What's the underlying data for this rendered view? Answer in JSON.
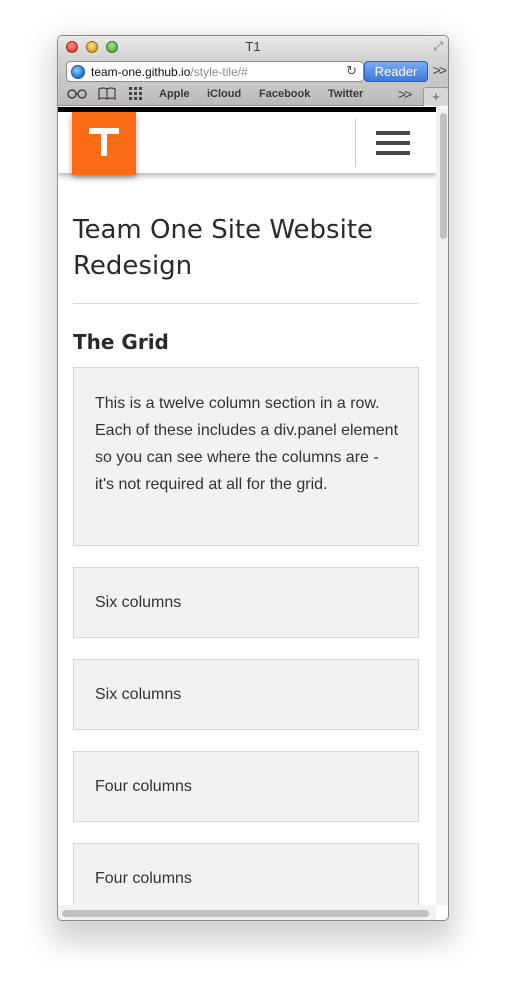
{
  "window": {
    "title": "T1",
    "url_host": "team-one.github.io",
    "url_path": "/style-tile/#",
    "reader_label": "Reader"
  },
  "bookmarks": [
    "Apple",
    "iCloud",
    "Facebook",
    "Twitter"
  ],
  "site": {
    "brand_color": "#fb6a14",
    "page_title": "Team One Site Website Redesign",
    "section_title": "The Grid",
    "panels": [
      "This is a twelve column section in a row. Each of these includes a div.panel element so you can see where the columns are - it's not required at all for the grid.",
      "Six columns",
      "Six columns",
      "Four columns",
      "Four columns"
    ]
  },
  "icons": {
    "reading_list": "glasses-icon",
    "bookmarks": "book-icon",
    "top_sites": "grid-icon",
    "menu": "hamburger-menu-icon"
  }
}
